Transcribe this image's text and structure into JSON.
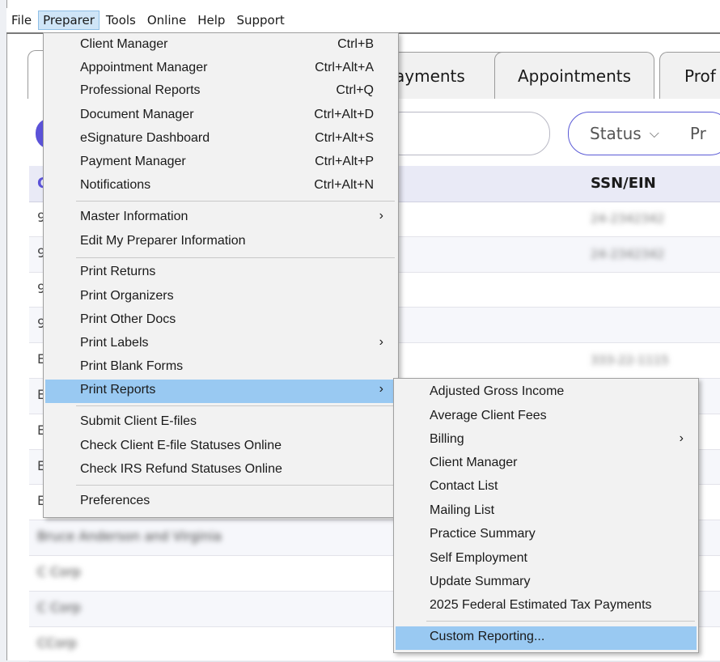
{
  "menubar": {
    "items": [
      "File",
      "Preparer",
      "Tools",
      "Online",
      "Help",
      "Support"
    ]
  },
  "tabs": {
    "payments": "ayments",
    "appointments": "Appointments",
    "prof": "Prof"
  },
  "filters": {
    "status": "Status",
    "pr": "Pr"
  },
  "table": {
    "col_first": "C",
    "col_ssn": "SSN/EIN",
    "rows": [
      {
        "c0": "9",
        "ssn": "24-2342342"
      },
      {
        "c0": "9",
        "ssn": "24-2342342"
      },
      {
        "c0": "9",
        "ssn": ""
      },
      {
        "c0": "9",
        "ssn": ""
      },
      {
        "c0": "E",
        "ssn": "333-22-1115"
      },
      {
        "c0": "E",
        "ssn": ""
      },
      {
        "c0": "E",
        "ssn": ""
      },
      {
        "c0": "E",
        "ssn": ""
      },
      {
        "c0": "E",
        "ssn": ""
      },
      {
        "c0": "Bruce Anderson and Virginia",
        "ssn": ""
      },
      {
        "c0": "C Corp",
        "ssn": ""
      },
      {
        "c0": "C Corp",
        "ssn": ""
      },
      {
        "c0": "CCorp",
        "ssn": ""
      }
    ]
  },
  "preparer_menu": [
    {
      "label": "Client Manager",
      "shortcut": "Ctrl+B"
    },
    {
      "label": "Appointment Manager",
      "shortcut": "Ctrl+Alt+A"
    },
    {
      "label": "Professional Reports",
      "shortcut": "Ctrl+Q"
    },
    {
      "label": "Document Manager",
      "shortcut": "Ctrl+Alt+D"
    },
    {
      "label": "eSignature Dashboard",
      "shortcut": "Ctrl+Alt+S"
    },
    {
      "label": "Payment Manager",
      "shortcut": "Ctrl+Alt+P"
    },
    {
      "label": "Notifications",
      "shortcut": "Ctrl+Alt+N"
    },
    {
      "label": "Master Information",
      "shortcut": ""
    },
    {
      "label": "Edit My Preparer Information",
      "shortcut": ""
    },
    {
      "label": "Print Returns",
      "shortcut": ""
    },
    {
      "label": "Print Organizers",
      "shortcut": ""
    },
    {
      "label": "Print Other Docs",
      "shortcut": ""
    },
    {
      "label": "Print Labels",
      "shortcut": ""
    },
    {
      "label": "Print Blank Forms",
      "shortcut": ""
    },
    {
      "label": "Print Reports",
      "shortcut": ""
    },
    {
      "label": "Submit Client E-files",
      "shortcut": ""
    },
    {
      "label": "Check Client E-file Statuses Online",
      "shortcut": ""
    },
    {
      "label": "Check IRS Refund Statuses Online",
      "shortcut": ""
    },
    {
      "label": "Preferences",
      "shortcut": ""
    }
  ],
  "reports_menu": [
    {
      "label": "Adjusted Gross Income"
    },
    {
      "label": "Average Client Fees"
    },
    {
      "label": "Billing"
    },
    {
      "label": "Client Manager"
    },
    {
      "label": "Contact List"
    },
    {
      "label": "Mailing List"
    },
    {
      "label": "Practice Summary"
    },
    {
      "label": "Self Employment"
    },
    {
      "label": "Update Summary"
    },
    {
      "label": "2025 Federal Estimated Tax Payments"
    },
    {
      "label": "Custom Reporting..."
    }
  ],
  "glyphs": {
    "submenu_arrow": "›",
    "status_chevron": "⌵"
  },
  "colors": {
    "highlight": "#99c9f2",
    "accent": "#5b52d8"
  }
}
